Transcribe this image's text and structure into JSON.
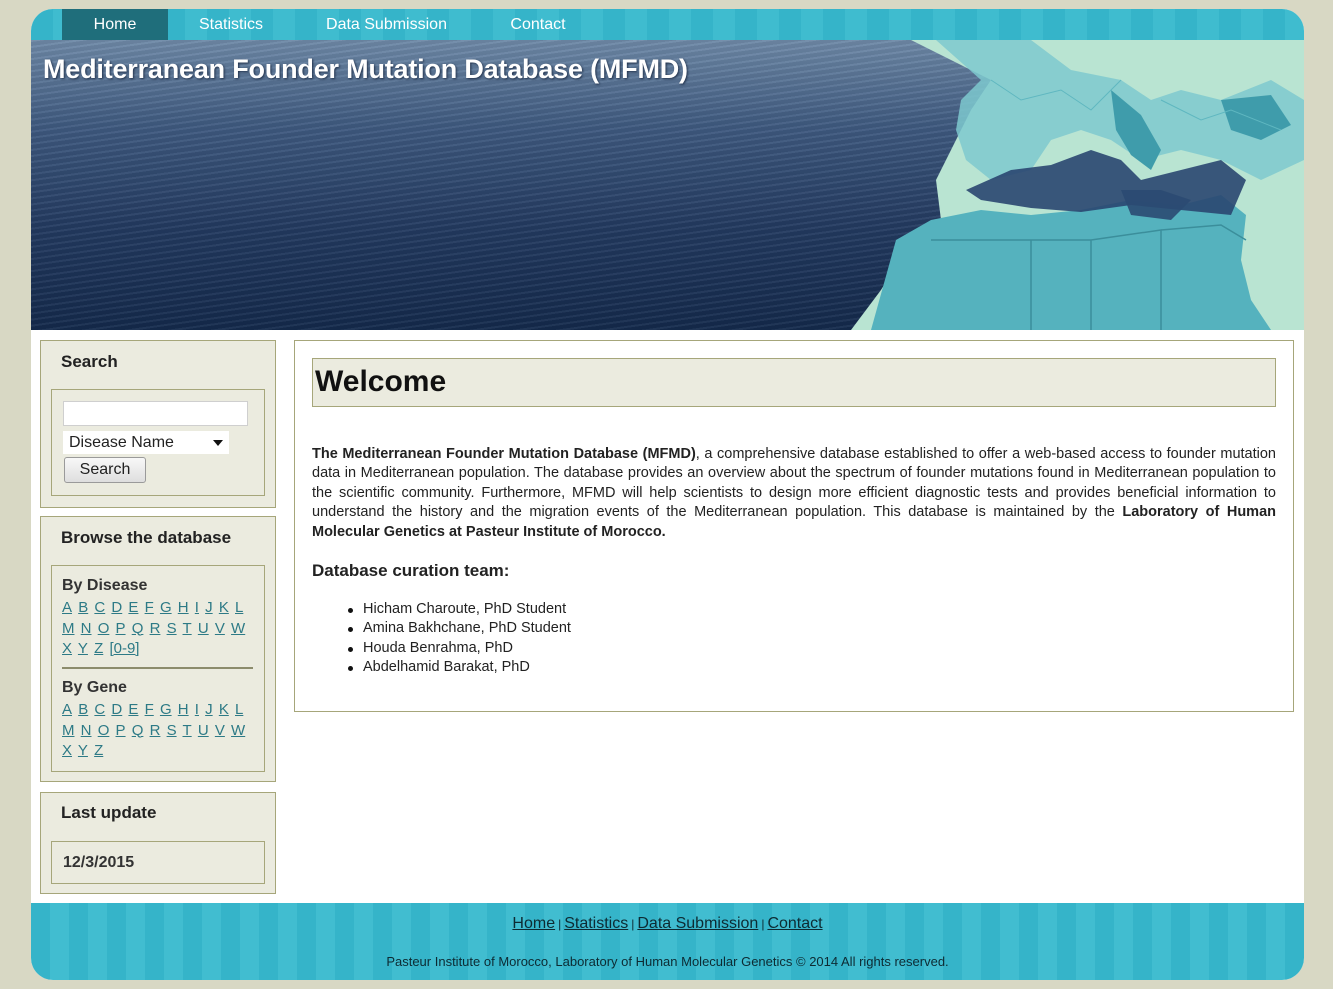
{
  "nav": {
    "items": [
      "Home",
      "Statistics",
      "Data Submission",
      "Contact"
    ],
    "active": "Home"
  },
  "banner": {
    "title": "Mediterranean Founder Mutation Database (MFMD)"
  },
  "search": {
    "heading": "Search",
    "input_value": "",
    "select_value": "Disease Name",
    "button_label": "Search"
  },
  "browse": {
    "heading": "Browse the database",
    "by_disease": {
      "heading": "By Disease",
      "letters": [
        "A",
        "B",
        "C",
        "D",
        "E",
        "F",
        "G",
        "H",
        "I",
        "J",
        "K",
        "L",
        "M",
        "N",
        "O",
        "P",
        "Q",
        "R",
        "S",
        "T",
        "U",
        "V",
        "W",
        "X",
        "Y",
        "Z",
        "[0-9]"
      ]
    },
    "by_gene": {
      "heading": "By Gene",
      "letters": [
        "A",
        "B",
        "C",
        "D",
        "E",
        "F",
        "G",
        "H",
        "I",
        "J",
        "K",
        "L",
        "M",
        "N",
        "O",
        "P",
        "Q",
        "R",
        "S",
        "T",
        "U",
        "V",
        "W",
        "X",
        "Y",
        "Z"
      ]
    }
  },
  "last_update": {
    "heading": "Last update",
    "date": "12/3/2015"
  },
  "main": {
    "welcome_title": "Welcome",
    "intro_bold_start": "The Mediterranean Founder Mutation Database (MFMD)",
    "intro_text": ", a comprehensive database established to offer a web-based access to founder mutation data in Mediterranean population. The database provides an overview about the spectrum of founder mutations found in Mediterranean population to the scientific community. Furthermore, MFMD will help scientists to design more efficient diagnostic tests and provides beneficial information to understand the history and the migration events of the Mediterranean population. This database is maintained by the ",
    "intro_bold_end": "Laboratory of Human Molecular Genetics at Pasteur Institute of Morocco.",
    "team_heading": "Database curation team:",
    "team": [
      "Hicham Charoute, PhD Student",
      "Amina Bakhchane, PhD Student",
      "Houda Benrahma, PhD",
      "Abdelhamid Barakat, PhD"
    ]
  },
  "footer": {
    "links": [
      "Home",
      "Statistics",
      "Data Submission",
      "Contact"
    ],
    "separator": "|",
    "copyright": "Pasteur Institute of Morocco, Laboratory of Human Molecular Genetics © 2014 All rights reserved."
  },
  "colors": {
    "nav_bar": "#35b4c9",
    "nav_active": "#1f6e7b",
    "box_bg": "#ebebdf",
    "box_border": "#a6a67a",
    "link": "#2d7a86",
    "page_bg": "#d8d8c4"
  }
}
